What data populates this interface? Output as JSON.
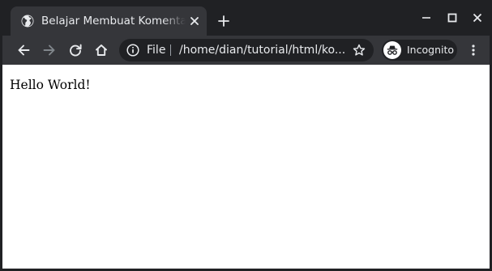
{
  "tab": {
    "title": "Belajar Membuat Komentar di HTML",
    "favicon": "globe-icon"
  },
  "window_controls": [
    "minimize-icon",
    "maximize-icon",
    "close-icon"
  ],
  "toolbar": {
    "back_icon": "arrow-back-icon",
    "forward_icon": "arrow-forward-icon",
    "reload_icon": "reload-icon",
    "home_icon": "home-icon",
    "menu_icon": "kebab-menu-icon"
  },
  "omnibox": {
    "scheme_label": "File",
    "url": "/home/dian/tutorial/html/ko...",
    "info_icon": "info-icon",
    "bookmark_icon": "star-icon"
  },
  "profile": {
    "label": "Incognito",
    "icon": "incognito-icon"
  },
  "page": {
    "body_text": "Hello World!"
  },
  "colors": {
    "frame": "#202124",
    "toolbar": "#35363a",
    "text_light": "#e8eaed",
    "icon": "#e8eaed",
    "icon_disabled": "#80868b",
    "page_background": "#ffffff"
  }
}
